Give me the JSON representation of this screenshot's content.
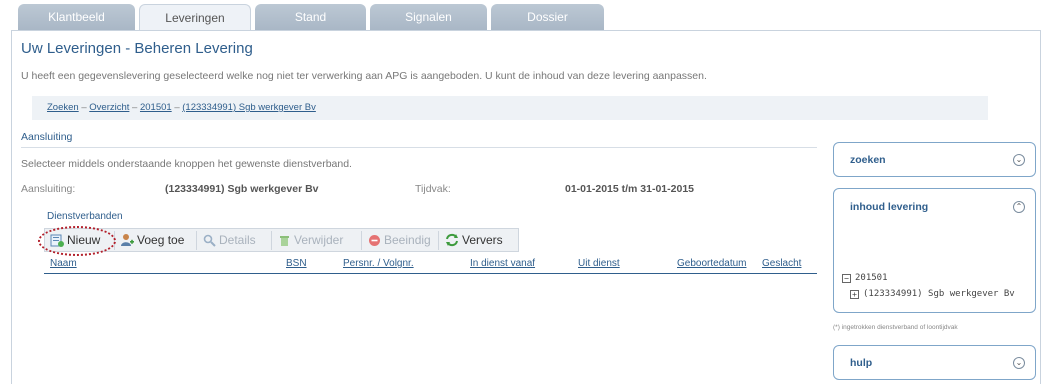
{
  "tabs": [
    {
      "label": "Klantbeeld",
      "active": false
    },
    {
      "label": "Leveringen",
      "active": true
    },
    {
      "label": "Stand",
      "active": false
    },
    {
      "label": "Signalen",
      "active": false
    },
    {
      "label": "Dossier",
      "active": false
    }
  ],
  "page": {
    "title": "Uw Leveringen - Beheren Levering",
    "intro": "U heeft een gegevenslevering geselecteerd welke nog niet ter verwerking aan APG is aangeboden. U kunt de inhoud van deze levering aanpassen."
  },
  "breadcrumb": {
    "items": [
      "Zoeken",
      "Overzicht",
      "201501",
      "(123334991) Sgb werkgever Bv"
    ],
    "separator": "–"
  },
  "aansluiting": {
    "section_title": "Aansluiting",
    "instruction": "Selecteer middels onderstaande knoppen het gewenste dienstverband.",
    "aansluiting_label": "Aansluiting:",
    "aansluiting_value": "(123334991) Sgb werkgever Bv",
    "tijdvak_label": "Tijdvak:",
    "tijdvak_value": "01-01-2015 t/m 31-01-2015"
  },
  "dienstverbanden": {
    "title": "Dienstverbanden",
    "toolbar": {
      "nieuw": "Nieuw",
      "voeg_toe": "Voeg toe",
      "details": "Details",
      "verwijder": "Verwijder",
      "beeindig": "Beeindig",
      "ververs": "Ververs"
    },
    "columns": [
      "Naam",
      "BSN",
      "Persnr. / Volgnr.",
      "In dienst vanaf",
      "Uit dienst",
      "Geboortedatum",
      "Geslacht"
    ]
  },
  "sidebar": {
    "zoeken": {
      "title": "zoeken",
      "toggle": "⌄"
    },
    "inhoud": {
      "title": "inhoud levering",
      "toggle": "⌃",
      "tree_root": "201501",
      "tree_root_box": "−",
      "tree_child": "(123334991) Sgb werkgever Bv",
      "tree_child_box": "+"
    },
    "footnote": "(*) ingetrokken dienstverband of loontijdvak",
    "hulp": {
      "title": "hulp",
      "toggle": "⌄"
    }
  },
  "colors": {
    "accent": "#2f5e8c",
    "tab_inactive": "#a9b7c6",
    "panel_border": "#7fa6c9",
    "highlight": "#b21f2a"
  }
}
